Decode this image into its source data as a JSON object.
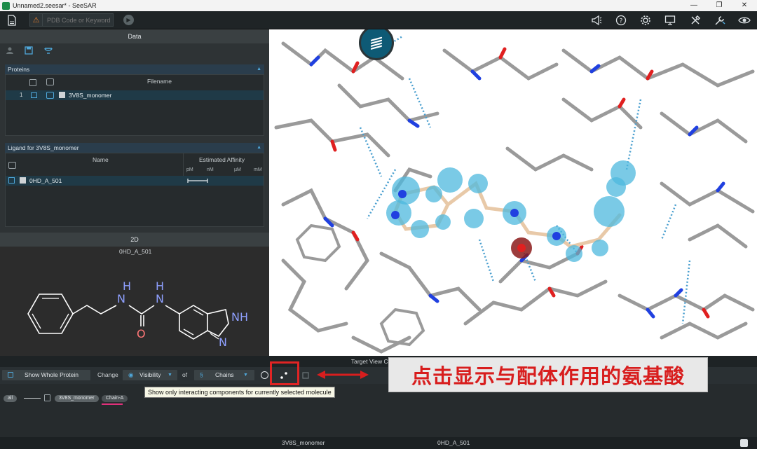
{
  "window": {
    "title": "Unnamed2.seesar* - SeeSAR",
    "buttons": [
      "—",
      "❐",
      "✕"
    ]
  },
  "toolbar": {
    "search_placeholder": "PDB Code or Keyword"
  },
  "data_panel": {
    "header": "Data",
    "proteins": {
      "title": "Proteins",
      "column_filename": "Filename",
      "rows": [
        {
          "index": "1",
          "filename": "3V8S_monomer"
        }
      ]
    },
    "ligands": {
      "title": "Ligand for 3V8S_monomer",
      "column_name": "Name",
      "column_affinity": "Estimated Affinity",
      "affinity_units": [
        "pM",
        "nM",
        "µM",
        "mM"
      ],
      "rows": [
        {
          "name": "0HD_A_501"
        }
      ]
    }
  },
  "panel_2d": {
    "header": "2D",
    "molecule_name": "0HD_A_501",
    "atoms": {
      "nh1": "H",
      "n1": "N",
      "nh2": "H",
      "n2": "N",
      "o": "O",
      "nh3": "NH",
      "n3": "N"
    }
  },
  "target_view_controls": {
    "header": "Target View Controls",
    "show_whole_protein": "Show Whole Protein",
    "change_label": "Change",
    "visibility": "Visibility",
    "of_label": "of",
    "chains": "Chains",
    "pills": [
      "all",
      "3V8S_monomer",
      "Chain-A"
    ],
    "tooltip": "Show only interacting components for currently selected molecule"
  },
  "annotation": {
    "text": "点击显示与配体作用的氨基酸"
  },
  "statusbar": {
    "protein": "3V8S_monomer",
    "ligand": "0HD_A_501"
  },
  "colors": {
    "accent": "#4fa7d9",
    "annotation_red": "#e02424",
    "carbon_gray": "#9a9a9a",
    "nitrogen_blue": "#2040e0",
    "oxygen_red": "#e02020"
  }
}
